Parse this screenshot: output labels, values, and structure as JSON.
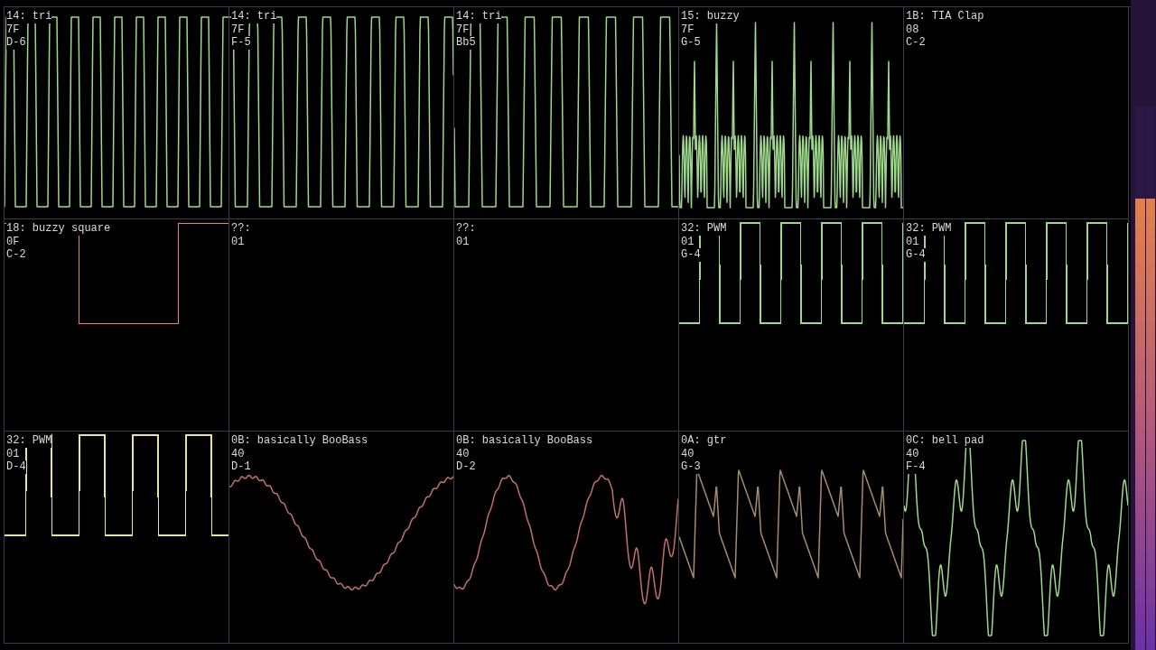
{
  "channels": [
    {
      "name": "14: tri",
      "volume": "7F",
      "note": "D-6",
      "kind": "pulse",
      "color": "#9ed88c"
    },
    {
      "name": "14: tri",
      "volume": "7F",
      "note": "F-5",
      "kind": "pulse",
      "color": "#9ed88c"
    },
    {
      "name": "14: tri",
      "volume": "7F",
      "note": "Bb5",
      "kind": "pulse",
      "color": "#9ed88c"
    },
    {
      "name": "15: buzzy",
      "volume": "7F",
      "note": "G-5",
      "kind": "buzzy",
      "color": "#9ed88c"
    },
    {
      "name": "1B: TIA Clap",
      "volume": "08",
      "note": "C-2",
      "kind": "silent"
    },
    {
      "name": "18: buzzy square",
      "volume": "0F",
      "note": "C-2",
      "kind": "square",
      "color": "#e8806a"
    },
    {
      "name": "??:",
      "volume": "01",
      "kind": "silent"
    },
    {
      "name": "??:",
      "volume": "01",
      "kind": "silent"
    },
    {
      "name": "32: PWM",
      "volume": "01",
      "note": "G-4",
      "kind": "pwm",
      "color": "#9ed88c"
    },
    {
      "name": "32: PWM",
      "volume": "01",
      "note": "G-4",
      "kind": "pwm",
      "color": "#9ed88c"
    },
    {
      "name": "32: PWM",
      "volume": "01",
      "note": "D-4",
      "kind": "pwm",
      "color": "#e6e49a"
    },
    {
      "name": "0B: basically BooBass",
      "volume": "40",
      "note": "D-1",
      "kind": "bass",
      "color": "#c4706a"
    },
    {
      "name": "0B: basically BooBass",
      "volume": "40",
      "note": "D-2",
      "kind": "bass",
      "color": "#c4706a"
    },
    {
      "name": "0A: gtr",
      "volume": "40",
      "note": "G-3",
      "kind": "pluck",
      "color": "#a48c6e"
    },
    {
      "name": "0C: bell pad",
      "volume": "40",
      "note": "F-4",
      "kind": "bell",
      "color": "#9ed88c"
    }
  ],
  "meters": [
    {
      "level": 0.83
    },
    {
      "level": 0.83
    }
  ]
}
